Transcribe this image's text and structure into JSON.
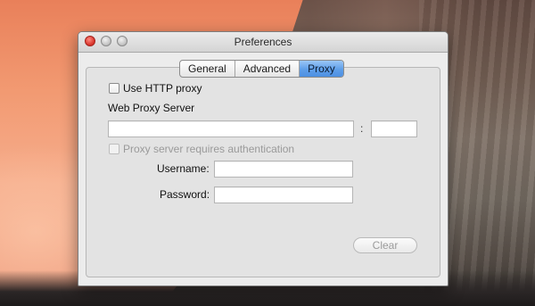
{
  "window": {
    "title": "Preferences"
  },
  "tabs": [
    {
      "label": "General",
      "active": false
    },
    {
      "label": "Advanced",
      "active": false
    },
    {
      "label": "Proxy",
      "active": true
    }
  ],
  "proxy": {
    "use_http_proxy_label": "Use HTTP proxy",
    "use_http_proxy_checked": false,
    "web_proxy_server_label": "Web Proxy Server",
    "server_value": "",
    "port_separator": ":",
    "port_value": "",
    "auth_label": "Proxy server requires authentication",
    "auth_checked": false,
    "auth_enabled": false,
    "username_label": "Username:",
    "username_value": "",
    "password_label": "Password:",
    "password_value": "",
    "clear_label": "Clear"
  },
  "colors": {
    "active_tab": "#5e9ee9",
    "close_light": "#d9352c",
    "disabled_text": "#9a9a9a"
  }
}
